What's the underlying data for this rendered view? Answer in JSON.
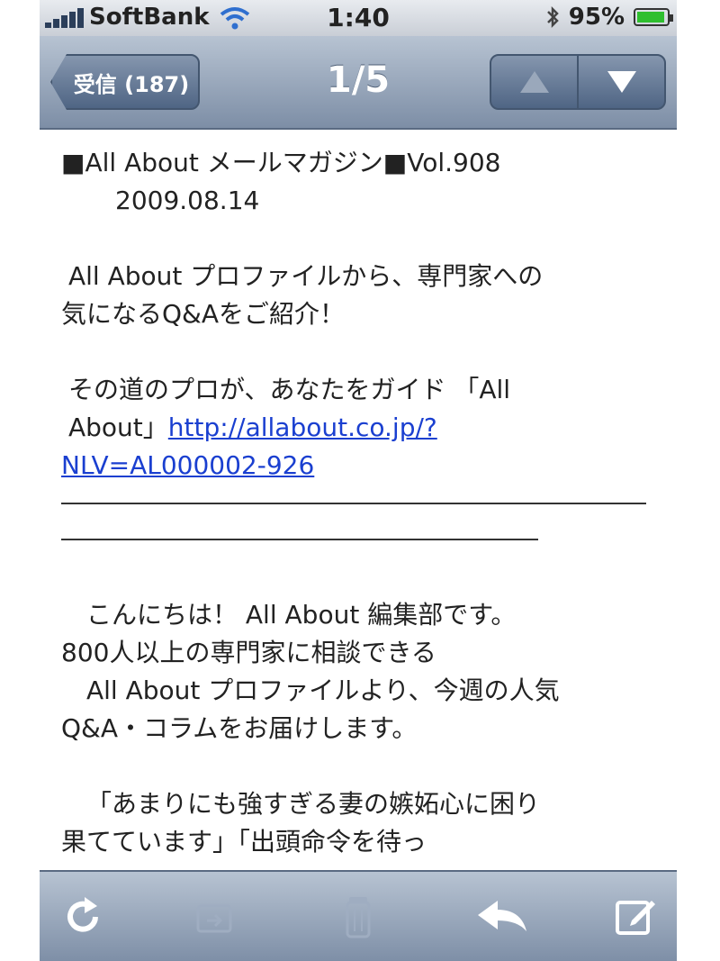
{
  "status_bar": {
    "carrier": "SoftBank",
    "time": "1:40",
    "battery": "95%",
    "battery_level": 0.95
  },
  "nav": {
    "back_label": "受信 (187)",
    "title": "1/5"
  },
  "mail": {
    "line1": "■All About メールマガジン■Vol.908",
    "date": "2009.08.14",
    "intro1": "All About プロファイルから、専門家への",
    "intro2": "気になるQ&Aをご紹介！",
    "guide1": "その道のプロが、あなたをガイド 「All",
    "guide2": "About」",
    "link1": "http://allabout.co.jp/?",
    "link2": "NLV=AL000002-926",
    "greet1": "こんにちは！ All About 編集部です。",
    "greet2": "800人以上の専門家に相談できる",
    "greet3": "All About プロファイルより、今週の人気",
    "greet4": "Q&A・コラムをお届けします。",
    "q1": "「あまりにも強すぎる妻の嫉妬心に困り",
    "q2": "果てています」「出頭命令を待っ"
  },
  "toolbar": {
    "icons": [
      "refresh-icon",
      "move-folder-icon",
      "trash-icon",
      "reply-icon",
      "compose-icon"
    ]
  },
  "colors": {
    "nav_top": "#b7c3d2",
    "nav_bottom": "#7d8ea6",
    "link": "#1a3fd0"
  }
}
